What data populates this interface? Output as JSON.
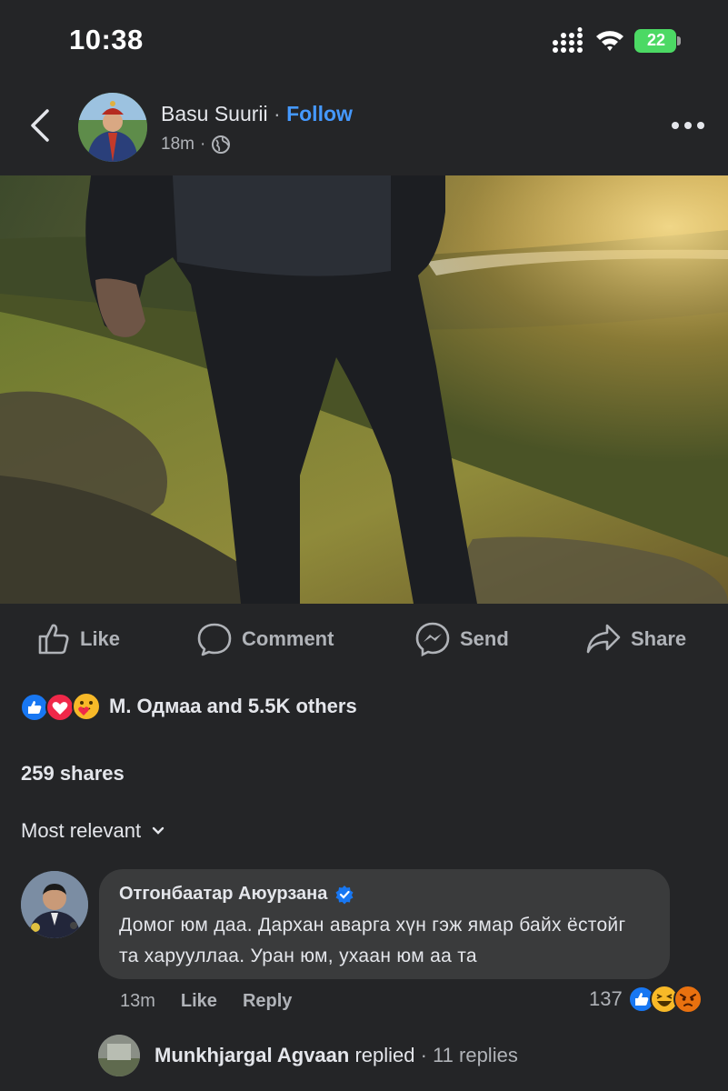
{
  "status": {
    "time": "10:38",
    "battery": "22"
  },
  "post": {
    "author": "Basu Suurii",
    "separator": "·",
    "follow": "Follow",
    "time": "18m",
    "meta_sep": "·",
    "audience_icon": "globe-icon"
  },
  "actions": {
    "like": "Like",
    "comment": "Comment",
    "send": "Send",
    "share": "Share"
  },
  "reactions": {
    "icons": [
      "like-icon",
      "love-icon",
      "care-icon"
    ],
    "summary": "М. Одмаа and 5.5K others"
  },
  "shares": "259 shares",
  "sort": {
    "label": "Most relevant"
  },
  "comment": {
    "author": "Отгонбаатар Аюурзана",
    "verified": true,
    "text": "Домог юм даа. Дархан аварга хүн гэж ямар байх ёстойг та харууллаа. Уран юм, ухаан юм аа та",
    "time": "13m",
    "like": "Like",
    "reply": "Reply",
    "reaction_count": "137",
    "reaction_icons": [
      "like-icon",
      "haha-icon",
      "angry-icon"
    ]
  },
  "reply_preview": {
    "name": "Munkhjargal Agvaan",
    "action": " replied",
    "sep": " · ",
    "count": "11 replies"
  },
  "colors": {
    "background": "#242527",
    "accent": "#4599ff",
    "muted": "#b0b3b8",
    "bubble": "#3a3b3c"
  }
}
